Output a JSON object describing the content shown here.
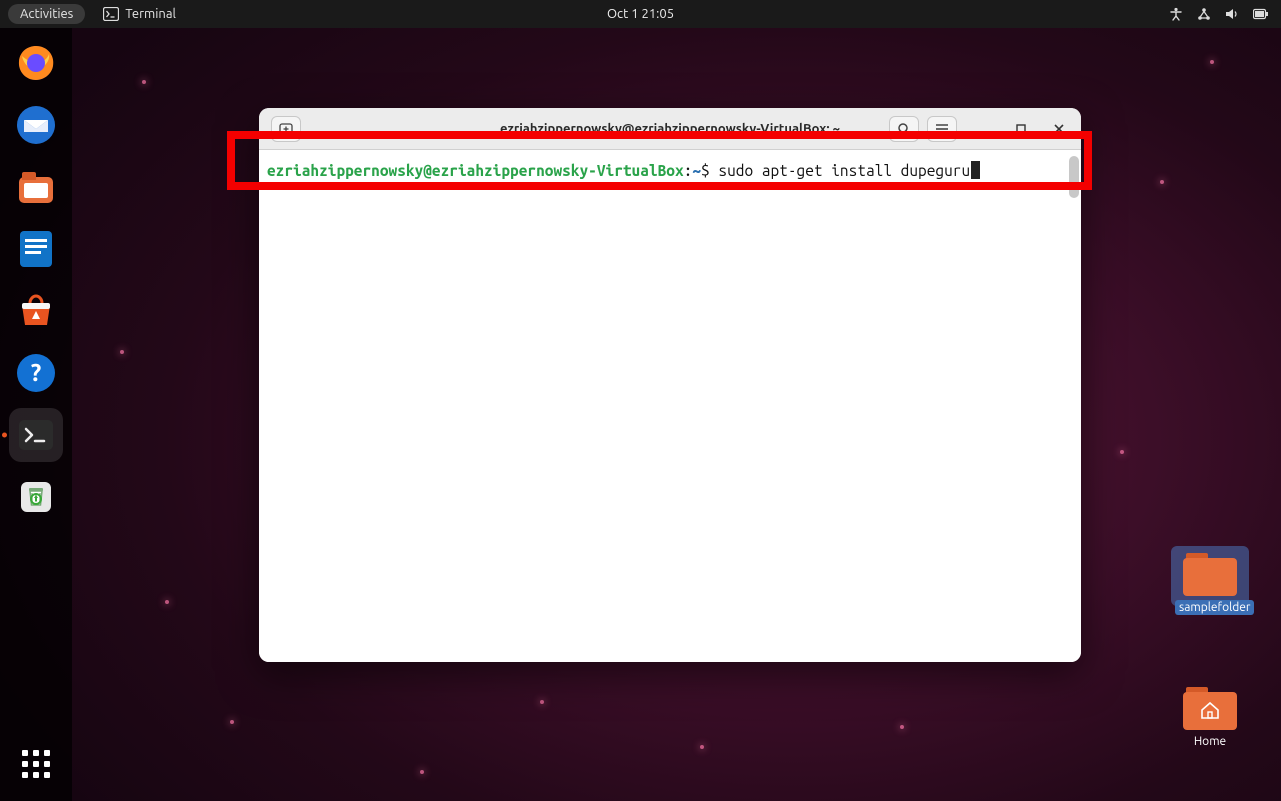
{
  "topbar": {
    "activities_label": "Activities",
    "app_indicator_label": "Terminal",
    "clock": "Oct 1  21:05"
  },
  "desktop": {
    "samplefolder_label": "samplefolder",
    "home_label": "Home"
  },
  "terminal": {
    "title": "ezriahzippernowsky@ezriahzippernowsky-VirtualBox: ~",
    "prompt_user_host": "ezriahzippernowsky@ezriahzippernowsky-VirtualBox",
    "prompt_colon": ":",
    "prompt_path": "~",
    "prompt_dollar": "$ ",
    "command": "sudo apt-get install dupeguru"
  }
}
